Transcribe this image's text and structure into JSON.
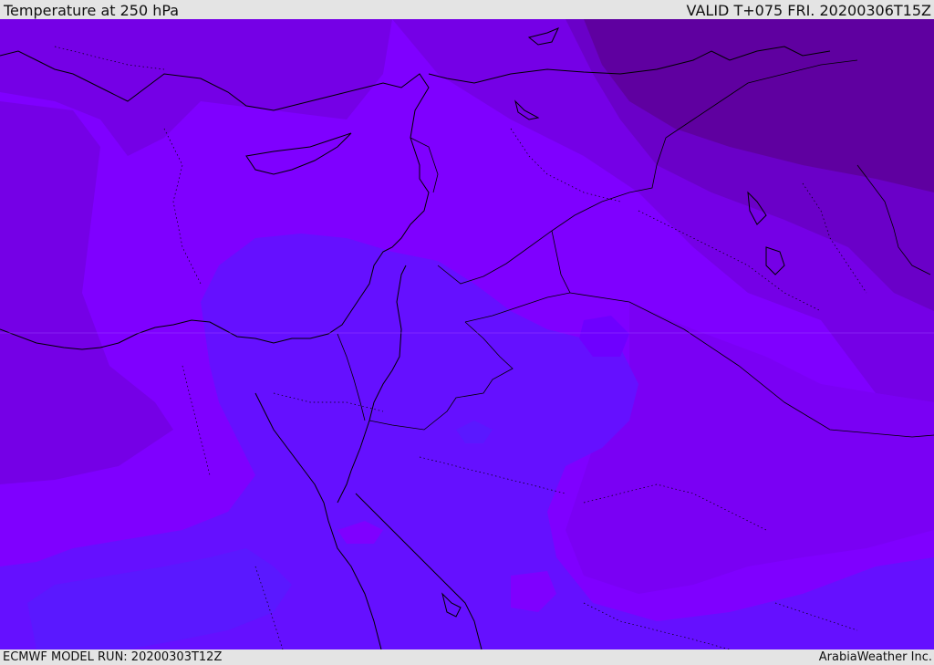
{
  "header": {
    "title": "Temperature at 250 hPa",
    "valid_time": "VALID T+075 FRI. 20200306T15Z"
  },
  "footer": {
    "model_run": "ECMWF MODEL RUN: 20200303T12Z",
    "provider": "ArabiaWeather Inc."
  },
  "colors": {
    "band_warmest": "#7f00ff",
    "band_warm": "#7500e6",
    "band_mid": "#6a00c8",
    "band_cool": "#5f00a0",
    "band_cold": "#6510ff",
    "band_coldest": "#5a18ff",
    "border": "#000000"
  }
}
